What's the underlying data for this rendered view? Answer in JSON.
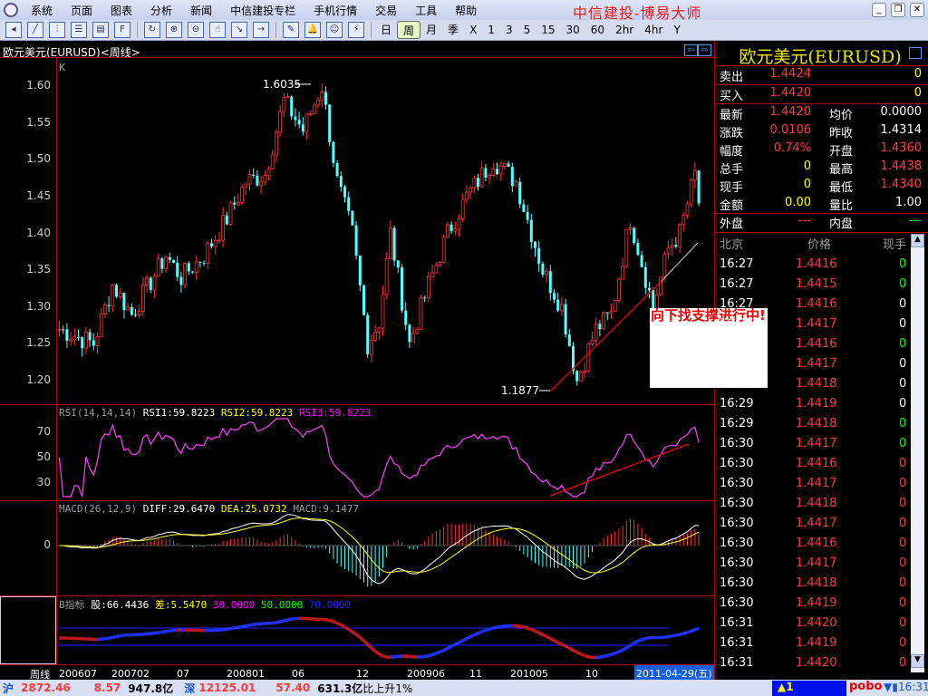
{
  "menu": {
    "items": [
      "系统",
      "页面",
      "图表",
      "分析",
      "新闻",
      "中信建投专栏",
      "手机行情",
      "交易",
      "工具",
      "帮助"
    ],
    "brand": "中信建投-博易大师"
  },
  "toolbar": {
    "periods": [
      "日",
      "周",
      "月",
      "季",
      "X",
      "1",
      "3",
      "5",
      "15",
      "30",
      "60",
      "2hr",
      "4hr",
      "Y"
    ],
    "active_period": "周"
  },
  "chart": {
    "title": "欧元美元(EURUSD)<周线>",
    "k_label": "K",
    "price_ticks": [
      "1.60",
      "1.55",
      "1.50",
      "1.45",
      "1.40",
      "1.35",
      "1.30",
      "1.25",
      "1.20"
    ],
    "high_label": "1.6035",
    "low_label": "1.1877",
    "annotation": "向下找支撑进行中!",
    "up_color": "#ff3232",
    "down_color": "#54ffff"
  },
  "rsi": {
    "name": "RSI(14,14,14)",
    "rsi1": "RSI1:59.8223",
    "rsi2": "RSI2:59.8223",
    "rsi3": "RSI3:59.8223",
    "ticks": [
      "70",
      "50",
      "30"
    ]
  },
  "macd": {
    "name": "MACD(26,12,9)",
    "diff": "DIFF:29.6470",
    "dea": "DEA:25.0732",
    "macd": "MACD:9.1477",
    "ticks": [
      "0"
    ]
  },
  "bind": {
    "name": "B指标",
    "gu": "股:66.4436",
    "cha": "差:5.5470",
    "l30": "30.0000",
    "l50": "50.0000",
    "l70": "70.0000"
  },
  "xaxis": {
    "period_label": "周线",
    "ticks": [
      "200607",
      "200702",
      "07",
      "200801",
      "06",
      "12",
      "200906",
      "11",
      "201005",
      "10"
    ],
    "cursor_date": "2011-04-29(五)"
  },
  "quote": {
    "title": "欧元美元(EURUSD)",
    "sell": {
      "label": "卖出",
      "price": "1.4424",
      "vol": "0"
    },
    "buy": {
      "label": "买入",
      "price": "1.4420",
      "vol": "0"
    },
    "rows": [
      {
        "l1": "最新",
        "v1": "1.4420",
        "c1": "red",
        "l2": "均价",
        "v2": "0.0000",
        "c2": "wht"
      },
      {
        "l1": "涨跌",
        "v1": "0.0106",
        "c1": "red",
        "l2": "昨收",
        "v2": "1.4314",
        "c2": "wht"
      },
      {
        "l1": "幅度",
        "v1": "0.74%",
        "c1": "red",
        "l2": "开盘",
        "v2": "1.4360",
        "c2": "red"
      },
      {
        "l1": "总手",
        "v1": "0",
        "c1": "yel",
        "l2": "最高",
        "v2": "1.4438",
        "c2": "red"
      },
      {
        "l1": "现手",
        "v1": "0",
        "c1": "yel",
        "l2": "最低",
        "v2": "1.4340",
        "c2": "red"
      },
      {
        "l1": "金额",
        "v1": "0.00",
        "c1": "yel",
        "l2": "量比",
        "v2": "1.00",
        "c2": "wht"
      }
    ],
    "outer": {
      "label": "外盘",
      "value": "---"
    },
    "inner": {
      "label": "内盘",
      "value": "---"
    },
    "trade_headers": [
      "北京",
      "价格",
      "现手"
    ],
    "trades": [
      [
        "16:27",
        "1.4416",
        "0",
        "grn"
      ],
      [
        "16:27",
        "1.4415",
        "0",
        "grn"
      ],
      [
        "16:27",
        "1.4416",
        "0",
        "wht"
      ],
      [
        "16:27",
        "1.4417",
        "0",
        "wht"
      ],
      [
        "16:28",
        "1.4416",
        "0",
        "grn"
      ],
      [
        "16:28",
        "1.4417",
        "0",
        "wht"
      ],
      [
        "16:28",
        "1.4418",
        "0",
        "wht"
      ],
      [
        "16:29",
        "1.4419",
        "0",
        "wht"
      ],
      [
        "16:29",
        "1.4418",
        "0",
        "grn"
      ],
      [
        "16:30",
        "1.4417",
        "0",
        "grn"
      ],
      [
        "16:30",
        "1.4416",
        "0",
        "red"
      ],
      [
        "16:30",
        "1.4417",
        "0",
        "red"
      ],
      [
        "16:30",
        "1.4418",
        "0",
        "red"
      ],
      [
        "16:30",
        "1.4417",
        "0",
        "red"
      ],
      [
        "16:30",
        "1.4416",
        "0",
        "red"
      ],
      [
        "16:30",
        "1.4417",
        "0",
        "red"
      ],
      [
        "16:30",
        "1.4418",
        "0",
        "red"
      ],
      [
        "16:30",
        "1.4419",
        "0",
        "red"
      ],
      [
        "16:31",
        "1.4420",
        "0",
        "red"
      ],
      [
        "16:31",
        "1.4419",
        "0",
        "red"
      ],
      [
        "16:31",
        "1.4420",
        "0",
        "red"
      ]
    ]
  },
  "status": {
    "sh_label": "沪",
    "sh_index": "2872.46",
    "sh_change": "8.57",
    "sh_amount": "947.8亿",
    "sz_label": "深",
    "sz_index": "12125.01",
    "sz_change": "57.40",
    "sz_amount": "631.3亿",
    "ratio": "比上升1%",
    "alert": "1",
    "pobo": "pobo",
    "time": "16:31"
  },
  "chart_data": {
    "type": "candlestick",
    "title": "欧元美元(EURUSD) 周线",
    "ylim": [
      1.18,
      1.62
    ],
    "anchor_closes": [
      [
        0,
        1.27
      ],
      [
        9,
        1.25
      ],
      [
        14,
        1.33
      ],
      [
        19,
        1.29
      ],
      [
        28,
        1.37
      ],
      [
        32,
        1.34
      ],
      [
        38,
        1.37
      ],
      [
        44,
        1.42
      ],
      [
        49,
        1.47
      ],
      [
        54,
        1.48
      ],
      [
        59,
        1.58
      ],
      [
        64,
        1.54
      ],
      [
        69,
        1.6
      ],
      [
        73,
        1.47
      ],
      [
        77,
        1.4
      ],
      [
        81,
        1.25
      ],
      [
        84,
        1.28
      ],
      [
        87,
        1.4
      ],
      [
        92,
        1.25
      ],
      [
        97,
        1.33
      ],
      [
        102,
        1.4
      ],
      [
        107,
        1.45
      ],
      [
        114,
        1.5
      ],
      [
        120,
        1.47
      ],
      [
        127,
        1.35
      ],
      [
        132,
        1.3
      ],
      [
        136,
        1.2
      ],
      [
        141,
        1.27
      ],
      [
        145,
        1.29
      ],
      [
        150,
        1.42
      ],
      [
        156,
        1.3
      ],
      [
        160,
        1.38
      ],
      [
        163,
        1.4
      ],
      [
        167,
        1.48
      ],
      [
        168,
        1.442
      ]
    ]
  }
}
